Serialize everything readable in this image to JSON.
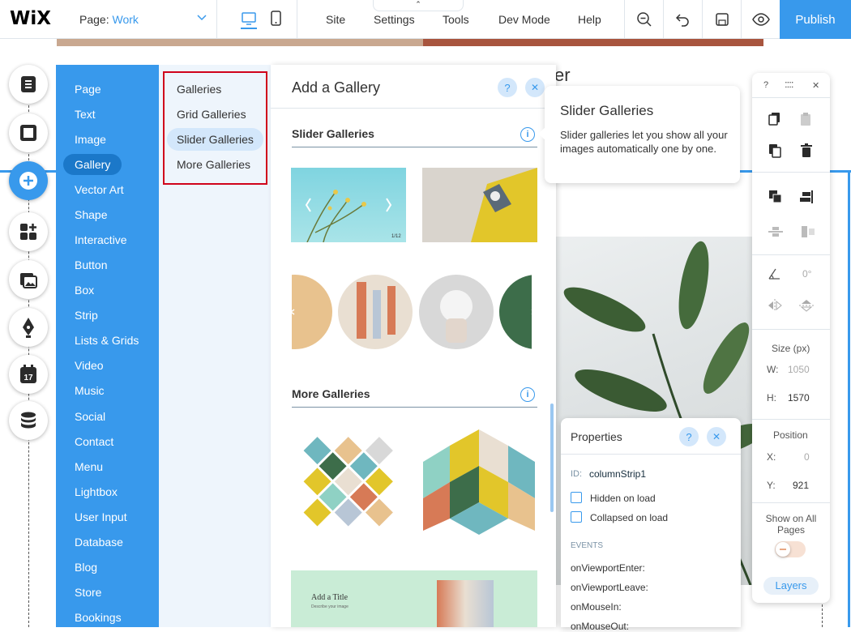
{
  "topbar": {
    "logo": "WiX",
    "page_label": "Page:",
    "page_value": "Work",
    "nav": [
      "Site",
      "Settings",
      "Tools",
      "Dev Mode",
      "Help"
    ],
    "publish": "Publish",
    "icons": [
      "desktop-icon",
      "mobile-icon",
      "zoom-out-icon",
      "undo-icon",
      "save-icon",
      "preview-icon"
    ]
  },
  "canvas": {
    "partial_heading": "er"
  },
  "rail": {
    "icons": [
      "menus-pages-icon",
      "background-icon",
      "add-icon",
      "add-apps-icon",
      "media-icon",
      "blog-pen-icon",
      "bookings-calendar-icon",
      "database-icon"
    ],
    "calendar_day": "17"
  },
  "categories": {
    "items": [
      "Page",
      "Text",
      "Image",
      "Gallery",
      "Vector Art",
      "Shape",
      "Interactive",
      "Button",
      "Box",
      "Strip",
      "Lists & Grids",
      "Video",
      "Music",
      "Social",
      "Contact",
      "Menu",
      "Lightbox",
      "User Input",
      "Database",
      "Blog",
      "Store",
      "Bookings"
    ],
    "selected": "Gallery"
  },
  "subcategories": {
    "items": [
      "Galleries",
      "Grid Galleries",
      "Slider Galleries",
      "More Galleries"
    ],
    "selected": "Slider Galleries"
  },
  "gallery_panel": {
    "title": "Add a Gallery",
    "help": "?",
    "close": "✕",
    "sections": [
      {
        "title": "Slider Galleries",
        "info": "i"
      },
      {
        "title": "More Galleries",
        "info": "i"
      }
    ],
    "slider_counter": "1/12",
    "preview_title": "Add a Title",
    "preview_sub": "Describe your image"
  },
  "tooltip": {
    "title": "Slider Galleries",
    "description": "Slider galleries let you show all your images automatically one by one."
  },
  "properties": {
    "title": "Properties",
    "help": "?",
    "close": "✕",
    "id_label": "ID:",
    "id_value": "columnStrip1",
    "options": [
      "Hidden on load",
      "Collapsed on load"
    ],
    "events_label": "EVENTS",
    "events": [
      "onViewportEnter:",
      "onViewportLeave:",
      "onMouseIn:",
      "onMouseOut:"
    ]
  },
  "right_toolbar": {
    "help": "?",
    "close": "✕",
    "rotation": "0°",
    "size_label": "Size (px)",
    "w_label": "W:",
    "w_value": "1050",
    "h_label": "H:",
    "h_value": "1570",
    "position_label": "Position",
    "x_label": "X:",
    "x_value": "0",
    "y_label": "Y:",
    "y_value": "921",
    "show_all": "Show on All Pages",
    "layers": "Layers"
  },
  "colors": {
    "accent": "#3899ec",
    "accent_dark": "#1b78c9",
    "highlight_box": "#d0021b"
  }
}
